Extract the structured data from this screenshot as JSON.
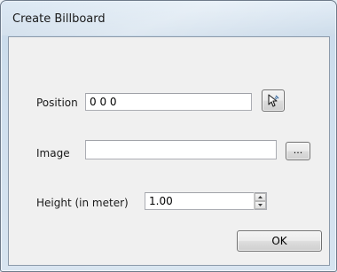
{
  "window": {
    "title": "Create Billboard"
  },
  "form": {
    "position": {
      "label": "Position",
      "value": "0 0 0"
    },
    "image": {
      "label": "Image",
      "value": "",
      "browse_label": "..."
    },
    "height": {
      "label": "Height (in meter)",
      "value": "1.00"
    }
  },
  "buttons": {
    "ok_label": "OK"
  },
  "icons": {
    "pick_position": "pointer-pick-icon",
    "spin_up": "spin-up-arrow-icon",
    "spin_down": "spin-down-arrow-icon"
  }
}
